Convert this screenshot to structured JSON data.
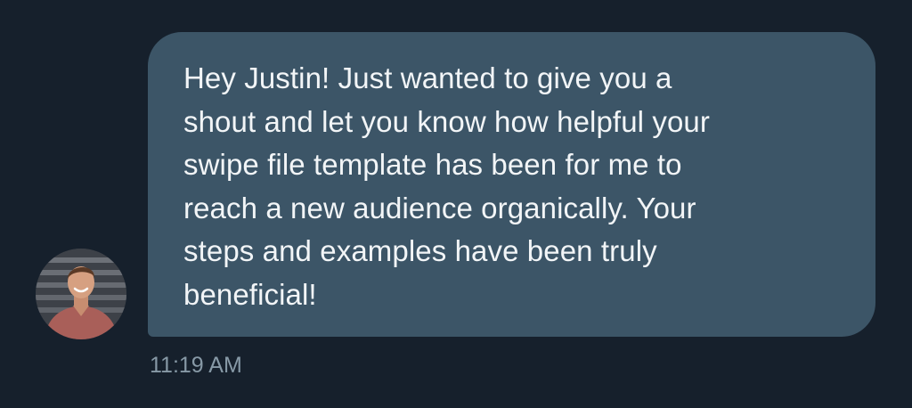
{
  "message": {
    "text": "Hey Justin! Just wanted to give you a\nshout and let you know how helpful your\nswipe file template has been for me to\nreach a new audience organically. Your\nsteps and examples have been truly\nbeneficial!",
    "timestamp": "11:19 AM"
  },
  "colors": {
    "background": "#16202c",
    "bubble": "#3c5567",
    "message_text": "#f2f5f7",
    "timestamp_text": "#8799a6"
  }
}
